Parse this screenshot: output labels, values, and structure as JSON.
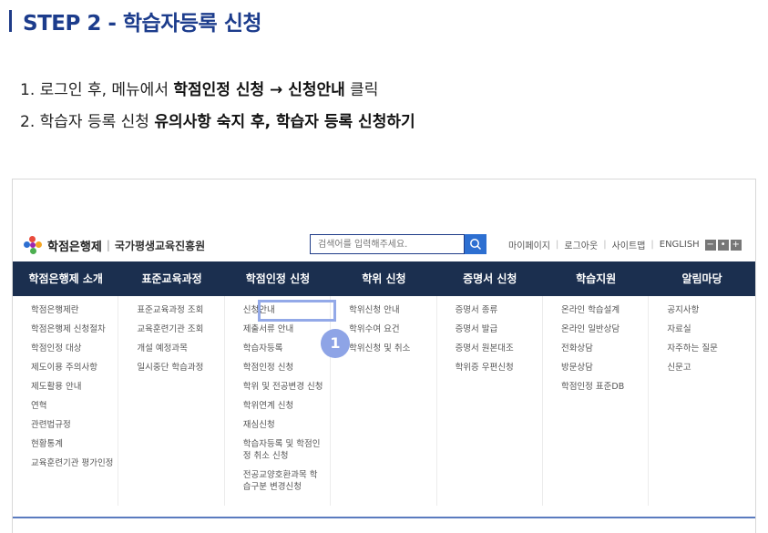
{
  "step": {
    "title": "STEP 2 - 학습자등록 신청"
  },
  "instructions": {
    "line1_pre": "1. 로그인 후, 메뉴에서 ",
    "line1_bold": "학점인정 신청 → 신청안내",
    "line1_post": " 클릭",
    "line2_pre": "2. 학습자 등록 신청 ",
    "line2_bold": "유의사항 숙지 후, 학습자 등록 신청하기"
  },
  "site": {
    "logo_name": "학점은행제",
    "logo_sep": "|",
    "logo_sub": "국가평생교육진흥원",
    "search_placeholder": "검색어를 입력해주세요.",
    "util_links": [
      "마이페이지",
      "로그아웃",
      "사이트맵",
      "ENGLISH"
    ],
    "font_controls": [
      "−",
      "•",
      "+"
    ]
  },
  "nav": {
    "items": [
      "학점은행제 소개",
      "표준교육과정",
      "학점인정 신청",
      "학위 신청",
      "증명서 신청",
      "학습지원",
      "알림마당"
    ]
  },
  "menu": {
    "columns": [
      [
        "학점은행제란",
        "학점은행제 신청절차",
        "학점인정 대상",
        "제도이용 주의사항",
        "제도활용 안내",
        "연혁",
        "관련법규정",
        "현황통계",
        "교육훈련기관 평가인정"
      ],
      [
        "표준교육과정 조회",
        "교육훈련기관 조회",
        "개설 예정과목",
        "일시중단 학습과정"
      ],
      [
        "신청안내",
        "제출서류 안내",
        "학습자등록",
        "학점인정 신청",
        "학위 및 전공변경 신청",
        "학위연계 신청",
        "재심신청",
        "학습자등록 및 학점인정 취소 신청",
        "전공교양호환과목 학습구분 변경신청"
      ],
      [
        "학위신청 안내",
        "학위수여 요건",
        "학위신청 및 취소"
      ],
      [
        "증명서 종류",
        "증명서 발급",
        "증명서 원본대조",
        "학위증 우편신청"
      ],
      [
        "온라인 학습설계",
        "온라인 일반상담",
        "전화상담",
        "방문상담",
        "학점인정 표준DB"
      ],
      [
        "공지사항",
        "자료실",
        "자주하는 질문",
        "신문고"
      ]
    ]
  },
  "annotation": {
    "badge": "1"
  },
  "colors": {
    "title": "#1c3c8c",
    "nav_bg": "#1b2f4f",
    "highlight": "#93a9e8",
    "search_btn": "#2d6fd1"
  }
}
